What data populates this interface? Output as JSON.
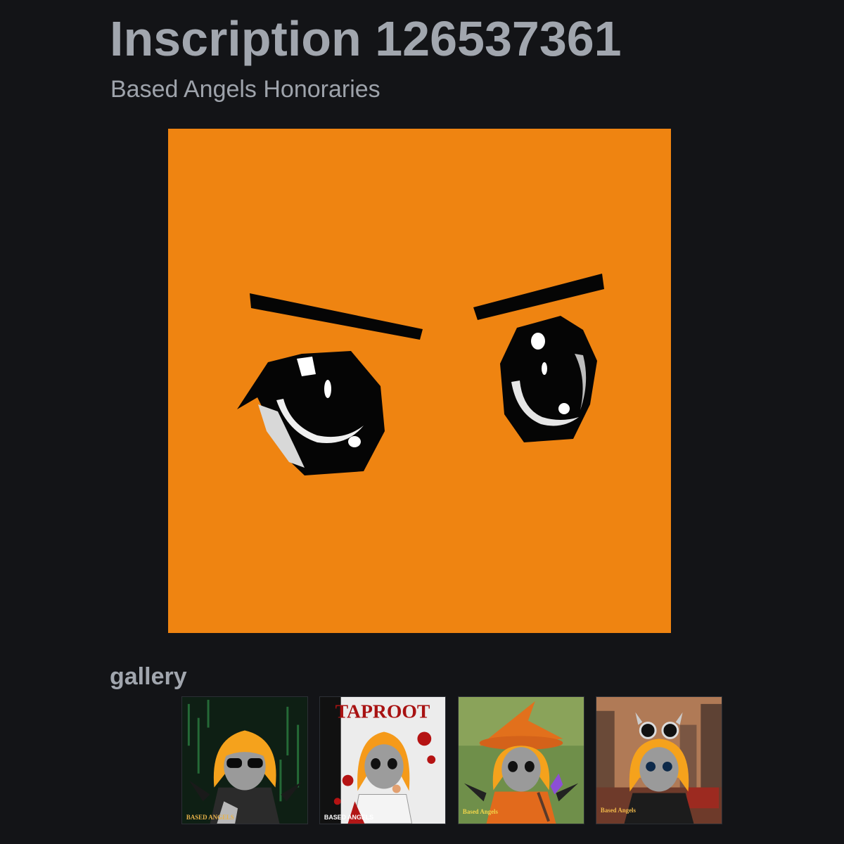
{
  "header": {
    "title": "Inscription 126537361",
    "collection": "Based Angels Honoraries"
  },
  "artwork": {
    "image": "orange-face-with-angry-anime-eyes",
    "background_color": "#ef8411"
  },
  "gallery": {
    "heading": "gallery",
    "items": [
      {
        "image": "matrix-angel-with-sunglasses",
        "caption": "BASED ANGELS",
        "accent": "#1b3a24"
      },
      {
        "image": "taproot-poster-angel",
        "caption": "BASED ANGELS",
        "title": "TAPROOT",
        "accent": "#b01515"
      },
      {
        "image": "witch-hat-angel-with-wand",
        "caption": "Based Angels",
        "accent": "#5c8a3a"
      },
      {
        "image": "punk-angel-with-goggles-city",
        "caption": "Based Angels",
        "accent": "#8a4f32"
      }
    ]
  }
}
